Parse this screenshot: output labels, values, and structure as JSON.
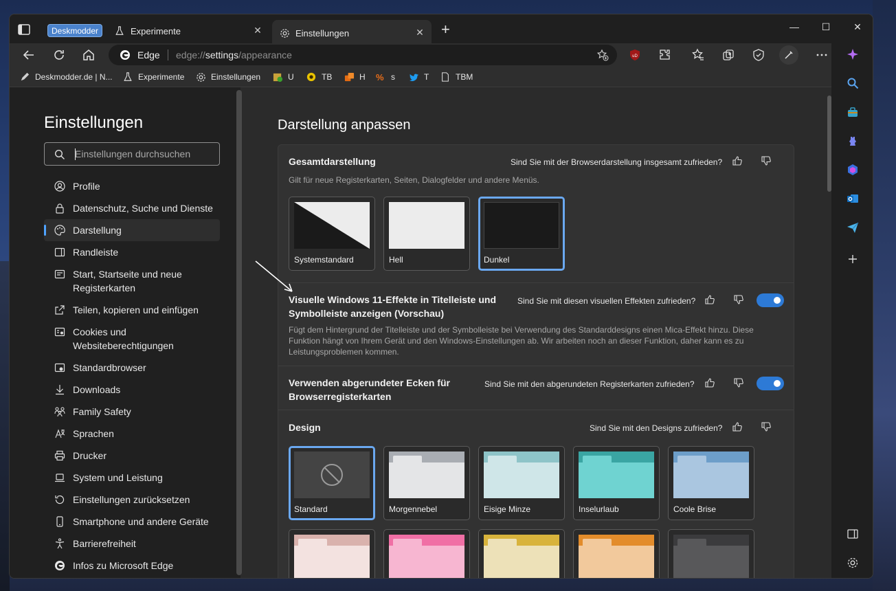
{
  "window": {
    "tabs": [
      {
        "label": "Experimente",
        "icon": "flask-icon"
      },
      {
        "label": "Einstellungen",
        "icon": "gear-icon"
      }
    ],
    "profile_pill": "Deskmodder"
  },
  "toolbar": {
    "site_name": "Edge",
    "url_scheme": "edge://",
    "url_host": "settings",
    "url_path": "/appearance"
  },
  "favorites": [
    {
      "label": "Deskmodder.de | N...",
      "icon": "pencil-icon"
    },
    {
      "label": "Experimente",
      "icon": "flask-icon"
    },
    {
      "label": "Einstellungen",
      "icon": "gear-icon"
    },
    {
      "label": "U",
      "icon": "u-icon"
    },
    {
      "label": "TB",
      "icon": "tb-icon"
    },
    {
      "label": "H",
      "icon": "h-icon"
    },
    {
      "label": "s",
      "icon": "s-icon"
    },
    {
      "label": "T",
      "icon": "twitter-icon"
    },
    {
      "label": "TBM",
      "icon": "page-icon"
    }
  ],
  "nav": {
    "title": "Einstellungen",
    "search_placeholder": "Einstellungen durchsuchen",
    "items": [
      {
        "label": "Profile",
        "icon": "profile-icon"
      },
      {
        "label": "Datenschutz, Suche und Dienste",
        "icon": "lock-icon"
      },
      {
        "label": "Darstellung",
        "icon": "palette-icon"
      },
      {
        "label": "Randleiste",
        "icon": "sidebar-icon"
      },
      {
        "label": "Start, Startseite und neue Registerkarten",
        "icon": "home-tabs-icon"
      },
      {
        "label": "Teilen, kopieren und einfügen",
        "icon": "share-icon"
      },
      {
        "label": "Cookies und Websiteberechtigungen",
        "icon": "cookie-icon"
      },
      {
        "label": "Standardbrowser",
        "icon": "browser-icon"
      },
      {
        "label": "Downloads",
        "icon": "download-icon"
      },
      {
        "label": "Family Safety",
        "icon": "family-icon"
      },
      {
        "label": "Sprachen",
        "icon": "language-icon"
      },
      {
        "label": "Drucker",
        "icon": "printer-icon"
      },
      {
        "label": "System und Leistung",
        "icon": "laptop-icon"
      },
      {
        "label": "Einstellungen zurücksetzen",
        "icon": "reset-icon"
      },
      {
        "label": "Smartphone und andere Geräte",
        "icon": "phone-icon"
      },
      {
        "label": "Barrierefreiheit",
        "icon": "accessibility-icon"
      },
      {
        "label": "Infos zu Microsoft Edge",
        "icon": "edge-icon"
      }
    ]
  },
  "main": {
    "title": "Darstellung anpassen",
    "overall": {
      "title": "Gesamtdarstellung",
      "question": "Sind Sie mit der Browserdarstellung insgesamt zufrieden?",
      "description": "Gilt für neue Registerkarten, Seiten, Dialogfelder und andere Menüs.",
      "options": [
        "Systemstandard",
        "Hell",
        "Dunkel"
      ],
      "selected": "Dunkel"
    },
    "mica": {
      "title": "Visuelle Windows 11-Effekte in Titelleiste und Symbolleiste anzeigen (Vorschau)",
      "question": "Sind Sie mit diesen visuellen Effekten zufrieden?",
      "description": "Fügt dem Hintergrund der Titelleiste und der Symbolleiste bei Verwendung des Standarddesigns einen Mica-Effekt hinzu. Diese Funktion hängt von Ihrem Gerät und den Windows-Einstellungen ab. Wir arbeiten noch an dieser Funktion, daher kann es zu Leistungsproblemen kommen.",
      "enabled": true
    },
    "rounded": {
      "title": "Verwenden abgerundeter Ecken für Browserregisterkarten",
      "question": "Sind Sie mit den abgerundeten Registerkarten zufrieden?",
      "enabled": true
    },
    "design": {
      "title": "Design",
      "question": "Sind Sie mit den Designs zufrieden?",
      "themes": [
        {
          "name": "Standard",
          "top": "#444444",
          "body": "#444444"
        },
        {
          "name": "Morgennebel",
          "top": "#a9adb3",
          "body": "#e4e5e7"
        },
        {
          "name": "Eisige Minze",
          "top": "#8ec4c8",
          "body": "#cfe6e8"
        },
        {
          "name": "Inselurlaub",
          "top": "#3aa5a3",
          "body": "#6fd3d1"
        },
        {
          "name": "Coole Brise",
          "top": "#6d9ec9",
          "body": "#aac6e0"
        }
      ],
      "themes_row2": [
        {
          "top": "#d9b2ad",
          "body": "#f3e2e0"
        },
        {
          "top": "#f06fa5",
          "body": "#f7b6d1"
        },
        {
          "top": "#d8b33c",
          "body": "#ede1b8"
        },
        {
          "top": "#e38c2b",
          "body": "#f2c99c"
        },
        {
          "top": "#3b3b3d",
          "body": "#58585a"
        }
      ],
      "selected": "Standard"
    }
  }
}
